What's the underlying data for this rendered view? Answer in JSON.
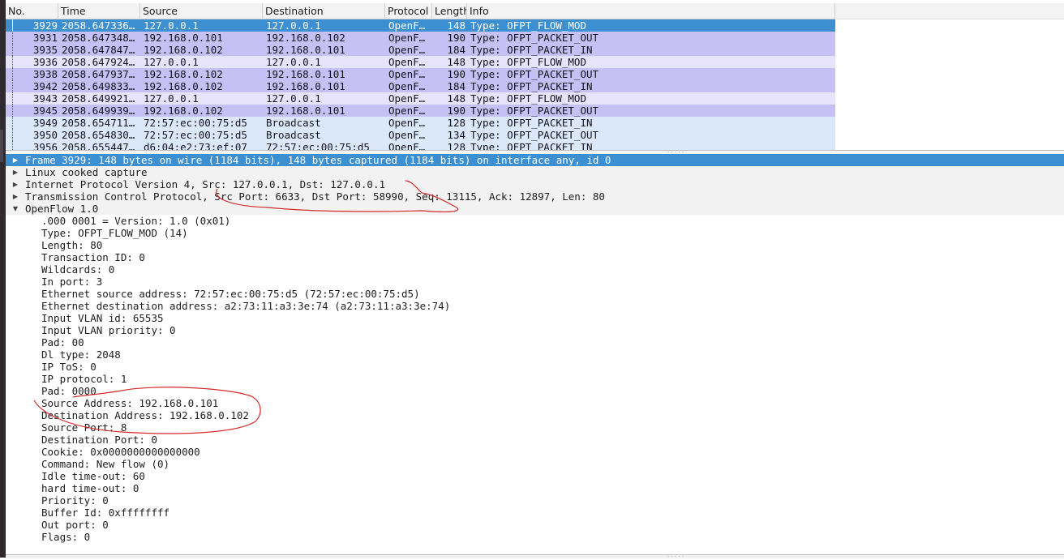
{
  "packet_list": {
    "columns": [
      "No.",
      "Time",
      "Source",
      "Destination",
      "Protocol",
      "Length",
      "Info"
    ],
    "rows": [
      {
        "no": "3929",
        "time": "2058.647336…",
        "source": "127.0.0.1",
        "destination": "127.0.0.1",
        "protocol": "OpenF…",
        "length": "148",
        "info": "Type: OFPT_FLOW_MOD",
        "style": "selected"
      },
      {
        "no": "3931",
        "time": "2058.647348…",
        "source": "192.168.0.101",
        "destination": "192.168.0.102",
        "protocol": "OpenF…",
        "length": "190",
        "info": "Type: OFPT_PACKET_OUT",
        "style": "purple"
      },
      {
        "no": "3935",
        "time": "2058.647847…",
        "source": "192.168.0.102",
        "destination": "192.168.0.101",
        "protocol": "OpenF…",
        "length": "184",
        "info": "Type: OFPT_PACKET_IN",
        "style": "purple"
      },
      {
        "no": "3936",
        "time": "2058.647924…",
        "source": "127.0.0.1",
        "destination": "127.0.0.1",
        "protocol": "OpenF…",
        "length": "148",
        "info": "Type: OFPT_FLOW_MOD",
        "style": "lightpurple"
      },
      {
        "no": "3938",
        "time": "2058.647937…",
        "source": "192.168.0.102",
        "destination": "192.168.0.101",
        "protocol": "OpenF…",
        "length": "190",
        "info": "Type: OFPT_PACKET_OUT",
        "style": "purple"
      },
      {
        "no": "3942",
        "time": "2058.649833…",
        "source": "192.168.0.102",
        "destination": "192.168.0.101",
        "protocol": "OpenF…",
        "length": "184",
        "info": "Type: OFPT_PACKET_IN",
        "style": "purple"
      },
      {
        "no": "3943",
        "time": "2058.649921…",
        "source": "127.0.0.1",
        "destination": "127.0.0.1",
        "protocol": "OpenF…",
        "length": "148",
        "info": "Type: OFPT_FLOW_MOD",
        "style": "lightpurple"
      },
      {
        "no": "3945",
        "time": "2058.649939…",
        "source": "192.168.0.102",
        "destination": "192.168.0.101",
        "protocol": "OpenF…",
        "length": "190",
        "info": "Type: OFPT_PACKET_OUT",
        "style": "purple"
      },
      {
        "no": "3949",
        "time": "2058.654711…",
        "source": "72:57:ec:00:75:d5",
        "destination": "Broadcast",
        "protocol": "OpenF…",
        "length": "128",
        "info": "Type: OFPT_PACKET_IN",
        "style": "blue"
      },
      {
        "no": "3950",
        "time": "2058.654830…",
        "source": "72:57:ec:00:75:d5",
        "destination": "Broadcast",
        "protocol": "OpenF…",
        "length": "134",
        "info": "Type: OFPT_PACKET_OUT",
        "style": "blue"
      },
      {
        "no": "3956",
        "time": "2058.655447…",
        "source": "d6:04:e2:73:ef:07",
        "destination": "72:57:ec:00:75:d5",
        "protocol": "OpenF…",
        "length": "128",
        "info": "Type: OFPT_PACKET_IN",
        "style": "blue"
      }
    ]
  },
  "details": {
    "top_items": [
      {
        "text": "Frame 3929: 148 bytes on wire (1184 bits), 148 bytes captured (1184 bits) on interface any, id 0",
        "state": "collapsed",
        "selected": true
      },
      {
        "text": "Linux cooked capture",
        "state": "collapsed",
        "selected": false
      },
      {
        "text": "Internet Protocol Version 4, Src: 127.0.0.1, Dst: 127.0.0.1",
        "state": "collapsed",
        "selected": false
      },
      {
        "text": "Transmission Control Protocol, Src Port: 6633, Dst Port: 58990, Seq: 13115, Ack: 12897, Len: 80",
        "state": "collapsed",
        "selected": false
      },
      {
        "text": "OpenFlow 1.0",
        "state": "expanded",
        "selected": false
      }
    ],
    "openflow_fields": [
      ".000 0001 = Version: 1.0 (0x01)",
      "Type: OFPT_FLOW_MOD (14)",
      "Length: 80",
      "Transaction ID: 0",
      "Wildcards: 0",
      "In port: 3",
      "Ethernet source address: 72:57:ec:00:75:d5 (72:57:ec:00:75:d5)",
      "Ethernet destination address: a2:73:11:a3:3e:74 (a2:73:11:a3:3e:74)",
      "Input VLAN id: 65535",
      "Input VLAN priority: 0",
      "Pad: 00",
      "Dl type: 2048",
      "IP ToS: 0",
      "IP protocol: 1",
      "Pad: 0000",
      "Source Address: 192.168.0.101",
      "Destination Address: 192.168.0.102",
      "Source Port: 8",
      "Destination Port: 0",
      "Cookie: 0x0000000000000000",
      "Command: New flow (0)",
      "Idle time-out: 60",
      "hard time-out: 0",
      "Priority: 0",
      "Buffer Id: 0xffffffff",
      "Out port: 0",
      "Flags: 0"
    ]
  },
  "colors": {
    "selected": "#3c8fd0",
    "purple_row": "#c6c0f5",
    "lightpurple_row": "#e6e3fb",
    "blue_row": "#dbe8fa",
    "annotation": "#d42a2a"
  }
}
